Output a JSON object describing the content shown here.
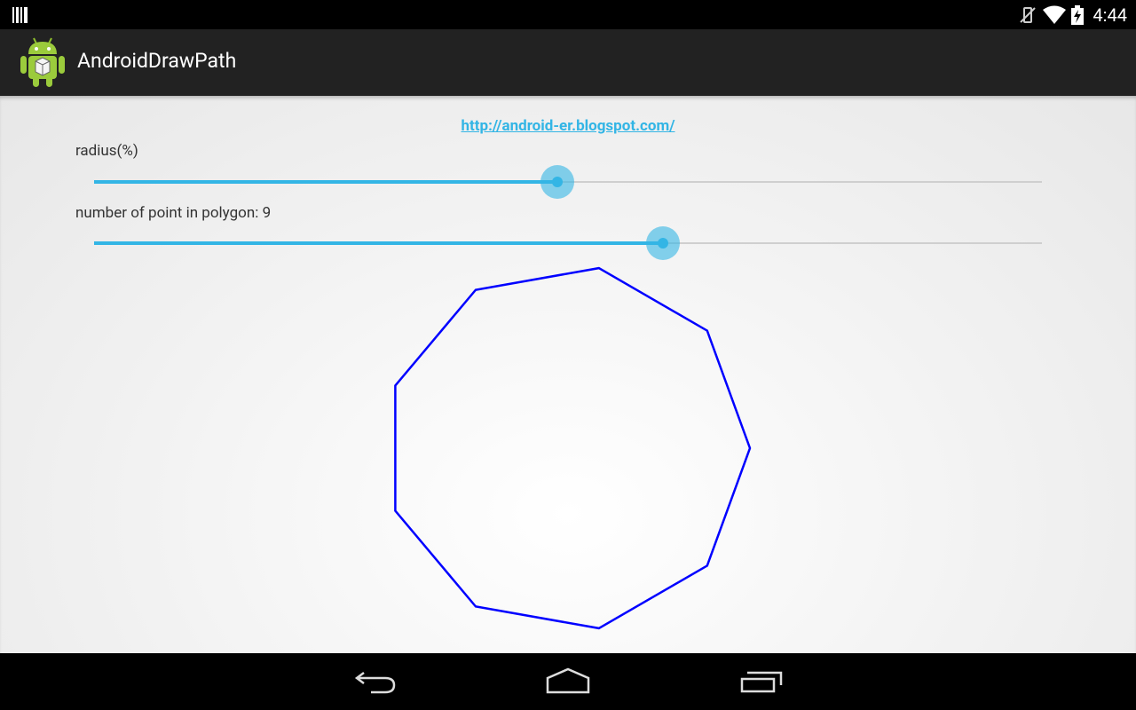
{
  "status_bar": {
    "time": "4:44",
    "icons": [
      "barcode-icon",
      "vibrate-off-icon",
      "wifi-icon",
      "battery-charging-icon"
    ]
  },
  "action_bar": {
    "title": "AndroidDrawPath",
    "icon": "android-app-icon"
  },
  "content": {
    "link_text": "http://android-er.blogspot.com/",
    "radius_label": "radius(%)",
    "radius_value_fraction": 0.489,
    "points_label": "number of point in polygon: 9",
    "points_value_fraction": 0.6,
    "polygon": {
      "points": 9,
      "stroke_color": "#0000ff"
    }
  },
  "colors": {
    "accent": "#33b5e5",
    "action_bar": "#222222"
  },
  "nav_bar": {
    "buttons": [
      "back-icon",
      "home-icon",
      "recents-icon"
    ]
  }
}
